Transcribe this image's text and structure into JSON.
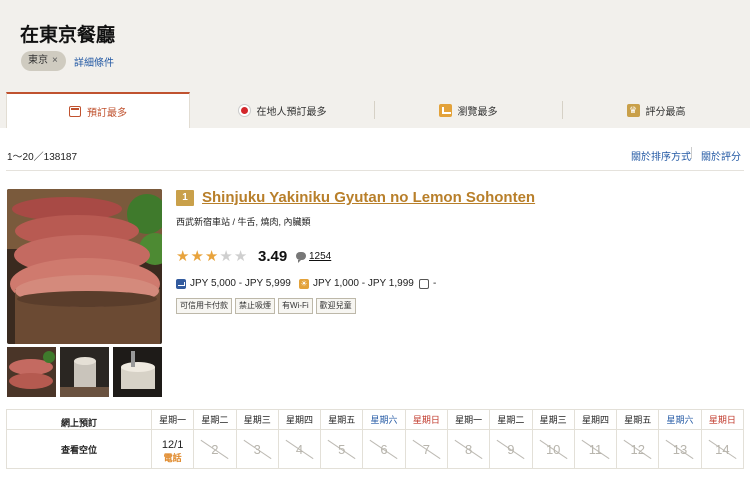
{
  "header": {
    "title": "在東京餐廳",
    "chip_label": "東京",
    "chip_remove": "×",
    "detail_link": "詳細條件"
  },
  "tabs": [
    {
      "label": "預訂最多",
      "icon": "calendar-icon",
      "active": true
    },
    {
      "label": "在地人預訂最多",
      "icon": "japan-flag-icon",
      "active": false
    },
    {
      "label": "瀏覽最多",
      "icon": "chart-icon",
      "active": false
    },
    {
      "label": "評分最高",
      "icon": "crown-icon",
      "active": false
    }
  ],
  "results": {
    "count": "1～20／138187",
    "sort_label": "關於排序方式",
    "rating_label": "關於評分"
  },
  "restaurant": {
    "rank": "1",
    "name": "Shinjuku Yakiniku Gyutan no Lemon Sohonten",
    "subtitle": "西武新宿車站 / 牛舌, 燒肉, 內臟類",
    "rating": "3.49",
    "stars_filled": 3,
    "stars_total": 5,
    "reviews": "1254",
    "price_dinner": "JPY 5,000 - JPY 5,999",
    "price_lunch": "JPY 1,000 - JPY 1,999",
    "price_other": "-",
    "tags": [
      "可信用卡付款",
      "禁止吸煙",
      "有Wi-Fi",
      "歡迎兒童"
    ]
  },
  "calendar": {
    "row1_label": "網上預訂",
    "row2_label": "查看空位",
    "days": [
      {
        "dow": "星期一",
        "type": "wd",
        "date": "12/1",
        "note": "電話"
      },
      {
        "dow": "星期二",
        "type": "wd",
        "date": "2"
      },
      {
        "dow": "星期三",
        "type": "wd",
        "date": "3"
      },
      {
        "dow": "星期四",
        "type": "wd",
        "date": "4"
      },
      {
        "dow": "星期五",
        "type": "wd",
        "date": "5"
      },
      {
        "dow": "星期六",
        "type": "sat",
        "date": "6"
      },
      {
        "dow": "星期日",
        "type": "sun",
        "date": "7"
      },
      {
        "dow": "星期一",
        "type": "wd",
        "date": "8"
      },
      {
        "dow": "星期二",
        "type": "wd",
        "date": "9"
      },
      {
        "dow": "星期三",
        "type": "wd",
        "date": "10"
      },
      {
        "dow": "星期四",
        "type": "wd",
        "date": "11"
      },
      {
        "dow": "星期五",
        "type": "wd",
        "date": "12"
      },
      {
        "dow": "星期六",
        "type": "sat",
        "date": "13"
      },
      {
        "dow": "星期日",
        "type": "sun",
        "date": "14"
      }
    ]
  },
  "colors": {
    "accent": "#c0522f",
    "link": "#2359a4",
    "name_gold": "#b87f2a",
    "star": "#e8a33c"
  }
}
